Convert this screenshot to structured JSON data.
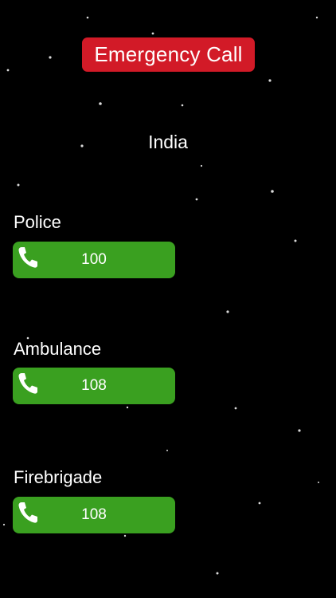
{
  "app": {
    "title": "Emergency Call",
    "country": "India"
  },
  "services": [
    {
      "label": "Police",
      "number": "100"
    },
    {
      "label": "Ambulance",
      "number": "108"
    },
    {
      "label": "Firebrigade",
      "number": "108"
    }
  ],
  "colors": {
    "background": "#000000",
    "title_badge": "#d21a27",
    "call_button": "#3aa020",
    "text": "#ffffff"
  },
  "icons": {
    "call_button": "phone-icon"
  }
}
